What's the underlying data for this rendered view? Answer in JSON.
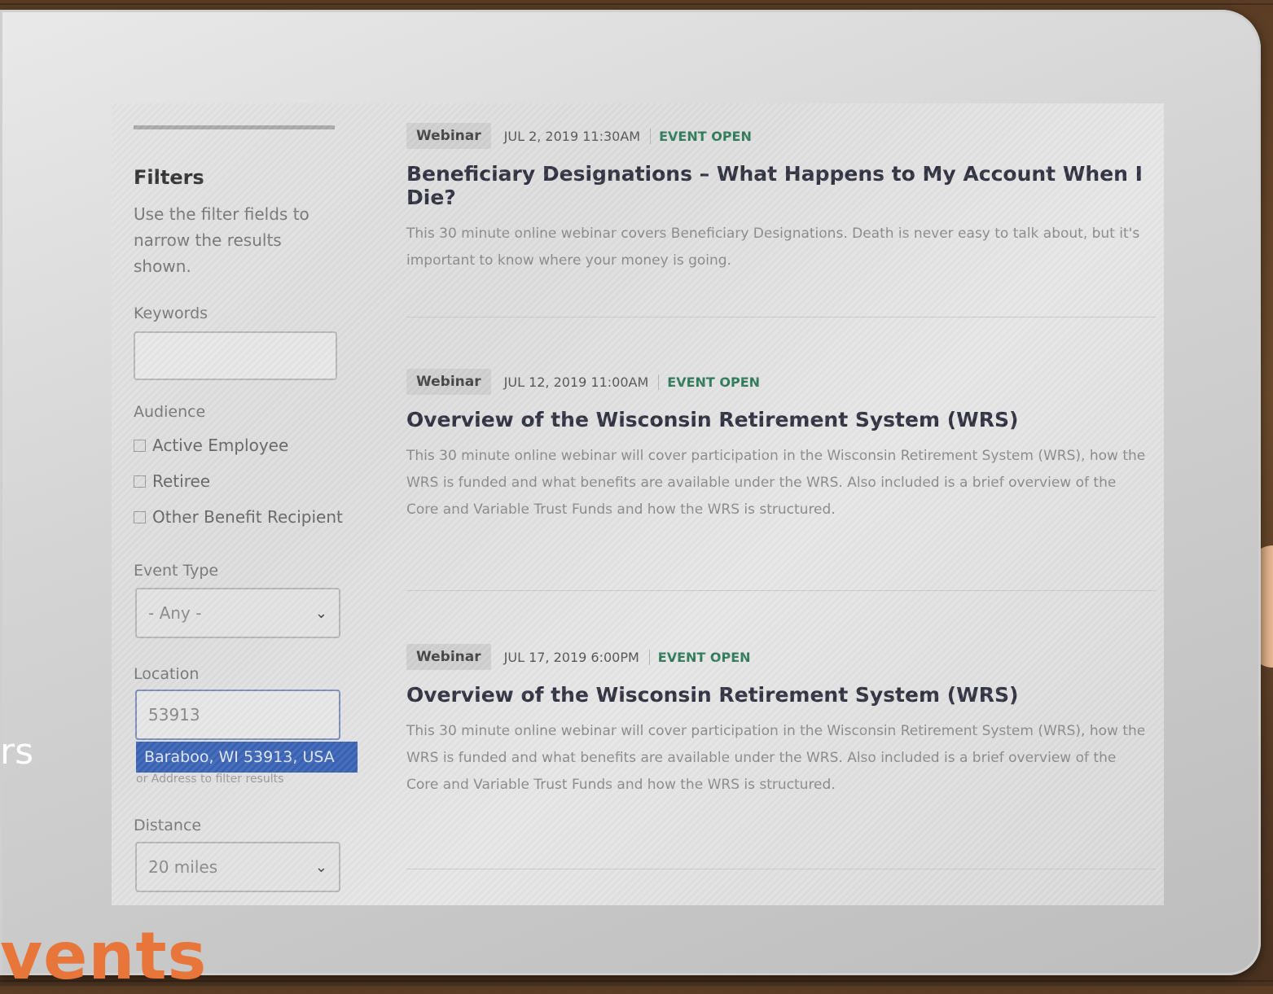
{
  "sidebar": {
    "title": "Filters",
    "description": "Use the filter fields to narrow the results shown.",
    "keywords_label": "Keywords",
    "keywords_value": "",
    "audience_label": "Audience",
    "audience_options": [
      "Active Employee",
      "Retiree",
      "Other Benefit Recipient"
    ],
    "event_type_label": "Event Type",
    "event_type_value": "- Any -",
    "location_label": "Location",
    "location_value": "53913",
    "location_suggestion": "Baraboo, WI 53913, USA",
    "location_hint": "or Address to filter results",
    "distance_label": "Distance",
    "distance_value": "20 miles"
  },
  "events": [
    {
      "type": "Webinar",
      "date": "JUL 2, 2019 11:30AM",
      "status": "EVENT OPEN",
      "title": "Beneficiary Designations – What Happens to My Account When I Die?",
      "description": "This 30 minute online webinar covers Beneficiary Designations. Death is never easy to talk about, but it's important to know where your money is going."
    },
    {
      "type": "Webinar",
      "date": "JUL 12, 2019 11:00AM",
      "status": "EVENT OPEN",
      "title": "Overview of the Wisconsin Retirement System (WRS)",
      "description": "This 30 minute online webinar will cover participation in the Wisconsin Retirement System (WRS), how the WRS is funded and what benefits are available under the WRS. Also included is a brief overview of the Core and Variable Trust Funds and how the WRS is structured."
    },
    {
      "type": "Webinar",
      "date": "JUL 17, 2019 6:00PM",
      "status": "EVENT OPEN",
      "title": "Overview of the Wisconsin Retirement System (WRS)",
      "description": "This 30 minute online webinar will cover participation in the Wisconsin Retirement System (WRS), how the WRS is funded and what benefits are available under the WRS. Also included is a brief overview of the Core and Variable Trust Funds and how the WRS is structured."
    }
  ],
  "overlay": {
    "side_text": "rs",
    "bottom_text": "vents"
  },
  "colors": {
    "accent_orange": "#e8763a",
    "status_green": "#2f7a5a",
    "suggestion_blue": "#3a63b5"
  }
}
